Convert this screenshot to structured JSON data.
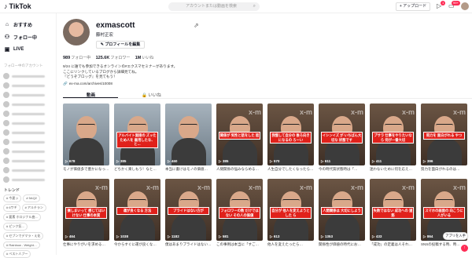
{
  "topbar": {
    "logo": "TikTok",
    "search_placeholder": "アカウントまたは動画を検索",
    "upload_label": "+ アップロード",
    "badge_messages": "1",
    "badge_inbox": "99+"
  },
  "sidebar": {
    "nav": [
      {
        "label": "おすすめ",
        "icon": "home-icon"
      },
      {
        "label": "フォロー中",
        "icon": "following-icon"
      },
      {
        "label": "LIVE",
        "icon": "live-icon"
      }
    ],
    "section_title": "フォロー中のアカウント",
    "trend_title": "トレンド",
    "tags": [
      "# 今夏ッ",
      "# 5AQ2",
      "# 6ワギ",
      "# アルチラン",
      "# 要素 ホロジナル曲…",
      "# ピンク気…",
      "# セブンでデマラ・え化",
      "# Rainbow - Weight…",
      "# ベスト人ブー"
    ]
  },
  "profile": {
    "username": "exmascott",
    "name": "藤村正宏",
    "edit_label": "プロフィールを編集",
    "following_count": "989",
    "following_label": "フォロー中",
    "followers_count": "125.6K",
    "followers_label": "フォロワー",
    "likes_count": "1M",
    "likes_label": "いいね",
    "bio_lines": [
      "9/24 に誰でも参加できるオンラインの#エクスマセミナーがあります。",
      "ここにリンクしているブログから詳細見てね。",
      "『どうぞブロッグ』を見てもう！"
    ],
    "link": "ex-ma.com/archives/10008"
  },
  "tabs": {
    "videos": "動画",
    "liked": "いいね"
  },
  "videos": [
    {
      "views": "678",
      "title": "モノが価値多で豊かになった…",
      "caption": ""
    },
    {
      "views": "385",
      "title": "どちかく楽しもう！なと…",
      "caption": "アルバイト面接の ズッたため人を 雇用したな、と…"
    },
    {
      "views": "460",
      "title": "本当に書けはモノの価値…",
      "caption": ""
    },
    {
      "views": "385",
      "title": "人間関係の悩みならめる…",
      "caption": "関係が 気性と話をした 話"
    },
    {
      "views": "570",
      "title": "人生自分でしたくなったら…",
      "caption": "我慢して自分の 後ろ向きになるの ろーい"
    },
    {
      "views": "611",
      "title": "今の時代質状態時は「…",
      "caption": "イシンイズ が いちばん大切な 状態です"
    },
    {
      "views": "411",
      "title": "迷わないために何を応え…",
      "caption": "ブサラ 仕事をやりたいなら 何が一番大切"
    },
    {
      "views": "396",
      "title": "努力を面白がれるのは…",
      "caption": "努力を 面白がれる やつ"
    },
    {
      "views": "464",
      "title": "仕事にやりがいを求める…",
      "caption": "損しまいって 感じてはいけない 仕事の本質"
    },
    {
      "views": "1038",
      "title": "今からすぐに運が良くな…",
      "caption": "運が良くなる 方法"
    },
    {
      "views": "1182",
      "title": "僕はあまりプライドはない…",
      "caption": "プライドはない方が"
    },
    {
      "views": "581",
      "title": "この事例は本当に「すご…",
      "caption": "フォロワーの数 だけではない その人の価値"
    },
    {
      "views": "613",
      "title": "他人を変えたったら…",
      "caption": "自分が 他人を変えようとした ら"
    },
    {
      "views": "1353",
      "title": "関係性が価値の時代にお…",
      "caption": "人間関係は 大切にしよう"
    },
    {
      "views": "433",
      "title": "「成功」の定義は人それ…",
      "caption": "失敗ではない 成功への 道筋"
    },
    {
      "views": "864",
      "title": "SNSの投稿する時、時…",
      "caption": "スマホの画面の 向こうに人がいる"
    }
  ],
  "toast": "アプリを入手",
  "colors": {
    "accent": "#fe2c55",
    "caption_red": "#e0211b"
  }
}
